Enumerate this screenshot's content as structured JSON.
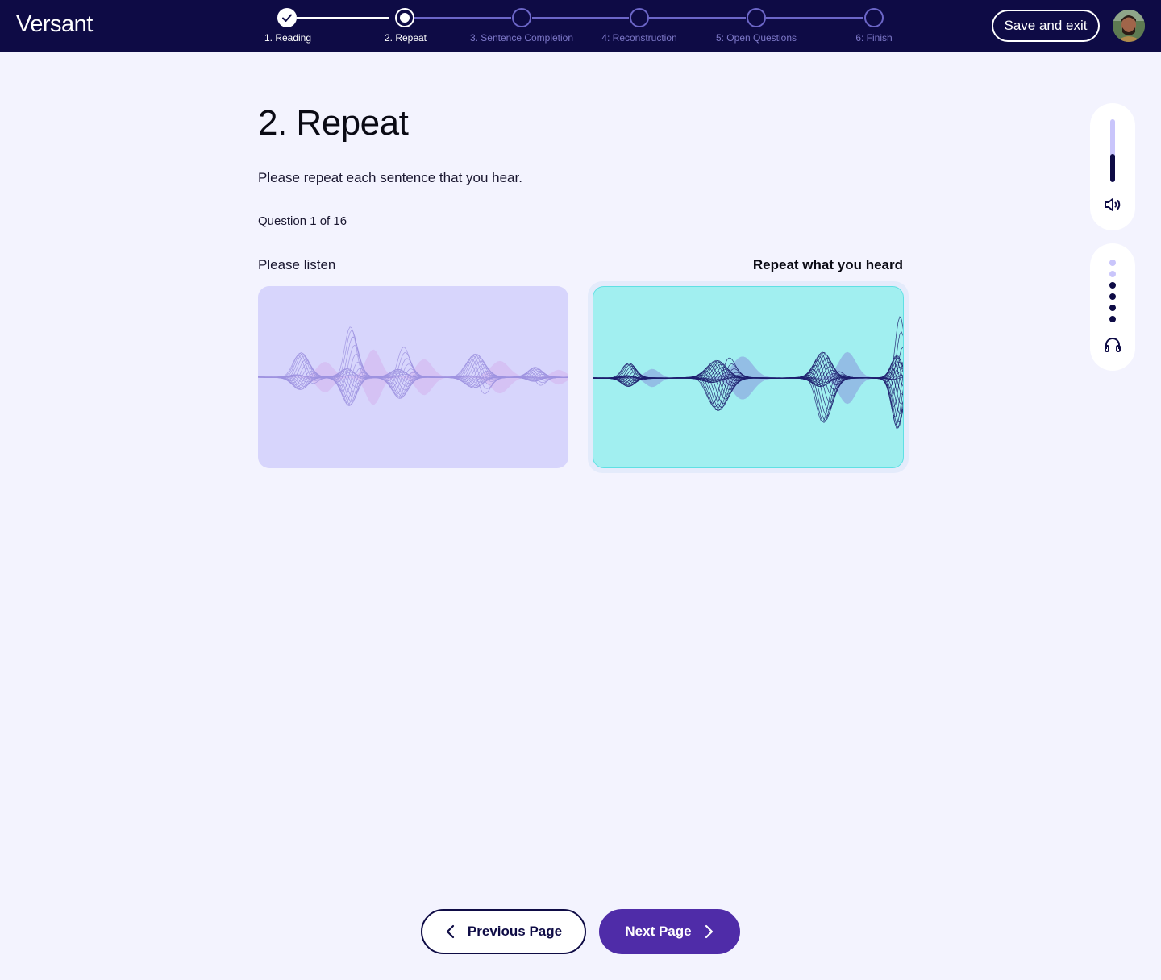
{
  "header": {
    "logo": "Versant",
    "save_exit_label": "Save and exit",
    "steps": [
      {
        "label": "1. Reading",
        "state": "done"
      },
      {
        "label": "2. Repeat",
        "state": "current"
      },
      {
        "label": "3. Sentence Completion",
        "state": "upcoming"
      },
      {
        "label": "4: Reconstruction",
        "state": "upcoming"
      },
      {
        "label": "5: Open Questions",
        "state": "upcoming"
      },
      {
        "label": "6: Finish",
        "state": "upcoming"
      }
    ]
  },
  "main": {
    "title": "2. Repeat",
    "instruction": "Please repeat each sentence that you hear.",
    "question_counter": "Question 1 of 16",
    "listen_label": "Please listen",
    "repeat_label": "Repeat what you heard"
  },
  "side": {
    "volume_level": 0.45,
    "volume_icon": "speaker-icon",
    "audio_icon": "headphones-icon",
    "audio_dots_total": 6,
    "audio_dots_active": 4
  },
  "footer": {
    "prev_label": "Previous Page",
    "next_label": "Next Page"
  },
  "colors": {
    "topbar": "#0e0b45",
    "listen_panel": "#d7d5fc",
    "repeat_panel": "#a1eff0",
    "next_button": "#4f2ca8",
    "wave_listen": "#9d92e0",
    "wave_repeat": "#1e1e6e"
  }
}
